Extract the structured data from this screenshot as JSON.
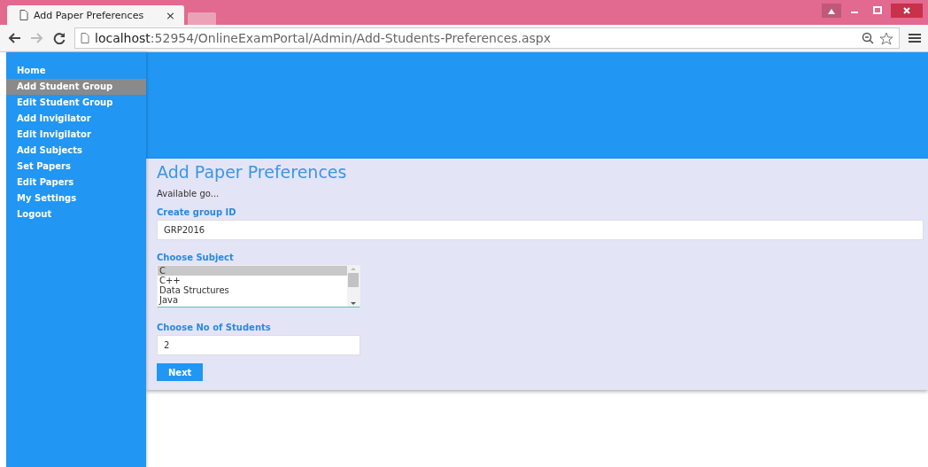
{
  "browser": {
    "tab_title": "Add Paper Preferences",
    "tab_close": "×",
    "url_host": "localhost",
    "url_path": ":52954/OnlineExamPortal/Admin/Add-Students-Preferences.aspx"
  },
  "sidebar": {
    "items": [
      {
        "label": "Home",
        "selected": false
      },
      {
        "label": "Add Student Group",
        "selected": true
      },
      {
        "label": "Edit Student Group",
        "selected": false
      },
      {
        "label": "Add Invigilator",
        "selected": false
      },
      {
        "label": "Edit Invigilator",
        "selected": false
      },
      {
        "label": "Add Subjects",
        "selected": false
      },
      {
        "label": "Set Papers",
        "selected": false
      },
      {
        "label": "Edit Papers",
        "selected": false
      },
      {
        "label": "My Settings",
        "selected": false
      },
      {
        "label": "Logout",
        "selected": false
      }
    ]
  },
  "form": {
    "title": "Add Paper Preferences",
    "note": "Available go...",
    "group_id": {
      "label": "Create group ID",
      "value": "GRP2016"
    },
    "subject": {
      "label": "Choose Subject",
      "options": [
        {
          "label": "C",
          "selected": true
        },
        {
          "label": "C++",
          "selected": false
        },
        {
          "label": "Data Structures",
          "selected": false
        },
        {
          "label": "Java",
          "selected": false
        }
      ]
    },
    "students": {
      "label": "Choose No of Students",
      "value": "2"
    },
    "button": "Next"
  }
}
